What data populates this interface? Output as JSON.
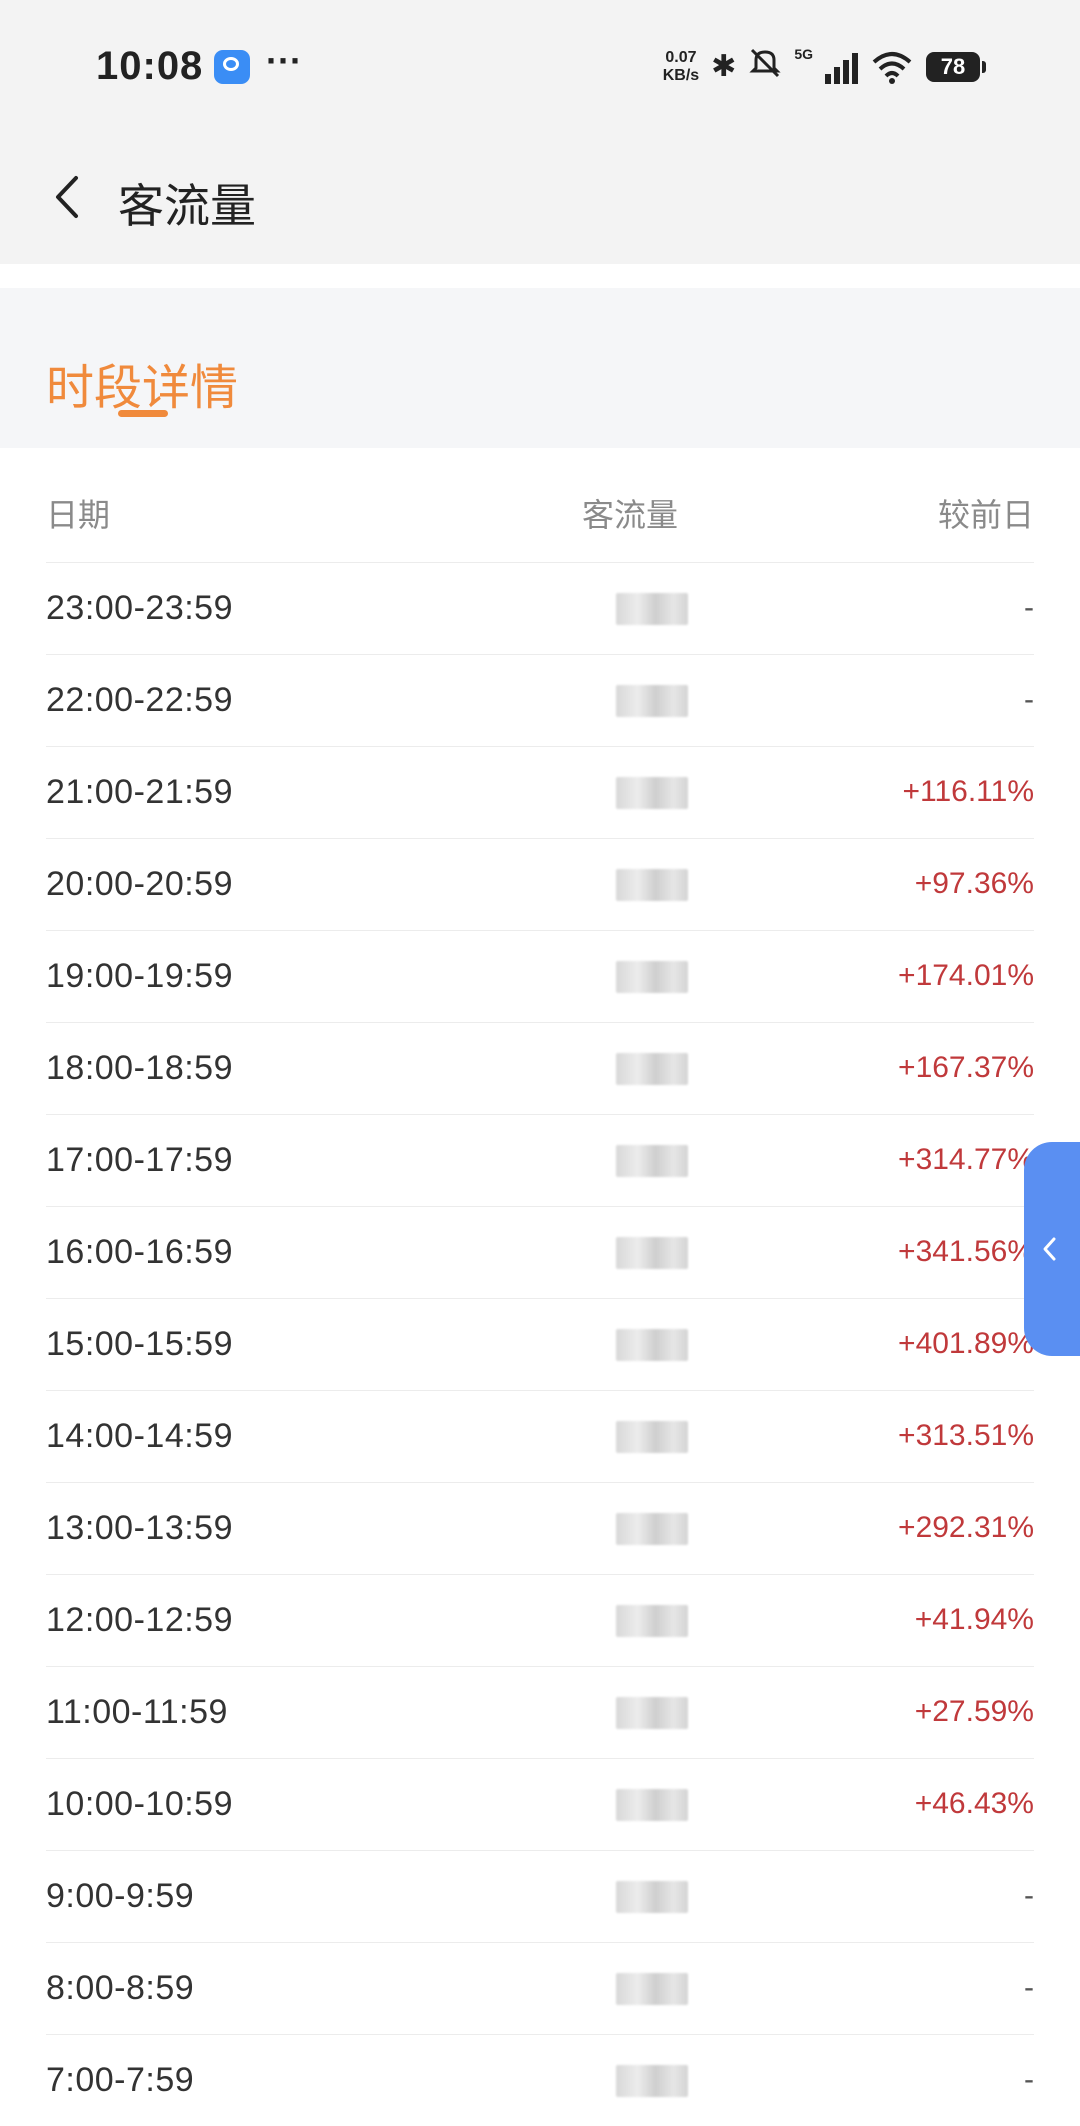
{
  "status_bar": {
    "time": "10:08",
    "more": "···",
    "net_speed_value": "0.07",
    "net_speed_unit": "KB/s",
    "network": "5G",
    "battery": "78"
  },
  "nav": {
    "title": "客流量"
  },
  "tabs": [
    {
      "label": "时段详情",
      "active": true
    }
  ],
  "table": {
    "headers": {
      "date": "日期",
      "flow": "客流量",
      "change": "较前日"
    },
    "rows": [
      {
        "period": "23:00-23:59",
        "change": "-"
      },
      {
        "period": "22:00-22:59",
        "change": "-"
      },
      {
        "period": "21:00-21:59",
        "change": "+116.11%"
      },
      {
        "period": "20:00-20:59",
        "change": "+97.36%"
      },
      {
        "period": "19:00-19:59",
        "change": "+174.01%"
      },
      {
        "period": "18:00-18:59",
        "change": "+167.37%"
      },
      {
        "period": "17:00-17:59",
        "change": "+314.77%"
      },
      {
        "period": "16:00-16:59",
        "change": "+341.56%"
      },
      {
        "period": "15:00-15:59",
        "change": "+401.89%"
      },
      {
        "period": "14:00-14:59",
        "change": "+313.51%"
      },
      {
        "period": "13:00-13:59",
        "change": "+292.31%"
      },
      {
        "period": "12:00-12:59",
        "change": "+41.94%"
      },
      {
        "period": "11:00-11:59",
        "change": "+27.59%"
      },
      {
        "period": "10:00-10:59",
        "change": "+46.43%"
      },
      {
        "period": "9:00-9:59",
        "change": "-"
      },
      {
        "period": "8:00-8:59",
        "change": "-"
      },
      {
        "period": "7:00-7:59",
        "change": "-"
      }
    ]
  },
  "colors": {
    "accent": "#f08a3c",
    "increase": "#c0393b",
    "side_handle": "#5a8ff2"
  }
}
